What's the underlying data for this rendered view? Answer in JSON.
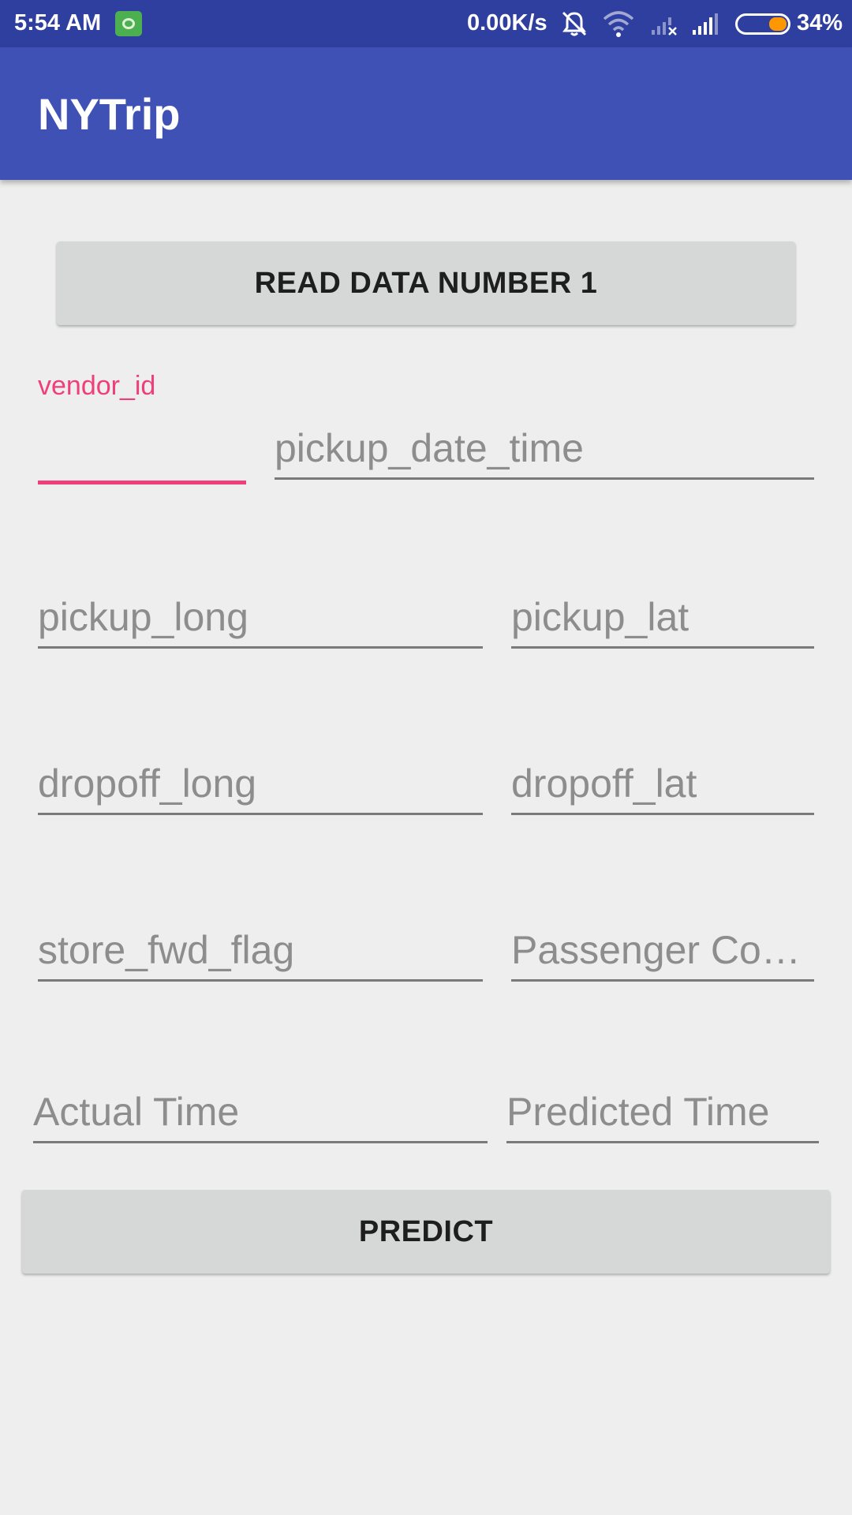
{
  "status_bar": {
    "time": "5:54 AM",
    "app_icon": "android-app-icon",
    "net_speed": "0.00K/s",
    "icons": [
      "mute-bell-icon",
      "wifi-icon",
      "signal-no-service-icon",
      "signal-icon"
    ],
    "battery_percent": "34%",
    "battery_level": 0.34,
    "battery_color": "#ff9800"
  },
  "app_bar": {
    "title": "NYTrip",
    "color": "#3f51b5"
  },
  "buttons": {
    "read": "READ DATA NUMBER 1",
    "predict": "PREDICT"
  },
  "form": {
    "vendor_id": {
      "label": "vendor_id",
      "value": "",
      "focused": true
    },
    "pickup_date_time": {
      "placeholder": "pickup_date_time",
      "value": ""
    },
    "pickup_long": {
      "placeholder": "pickup_long",
      "value": ""
    },
    "pickup_lat": {
      "placeholder": "pickup_lat",
      "value": ""
    },
    "dropoff_long": {
      "placeholder": "dropoff_long",
      "value": ""
    },
    "dropoff_lat": {
      "placeholder": "dropoff_lat",
      "value": ""
    },
    "store_fwd_flag": {
      "placeholder": "store_fwd_flag",
      "value": ""
    },
    "passenger_count": {
      "placeholder": "Passenger Co…",
      "value": ""
    },
    "actual_time": {
      "placeholder": "Actual  Time",
      "value": ""
    },
    "predicted_time": {
      "placeholder": "Predicted Time",
      "value": ""
    }
  },
  "colors": {
    "accent": "#ee3f7a",
    "status_bar": "#2f3f9f",
    "background": "#eeeeee"
  }
}
